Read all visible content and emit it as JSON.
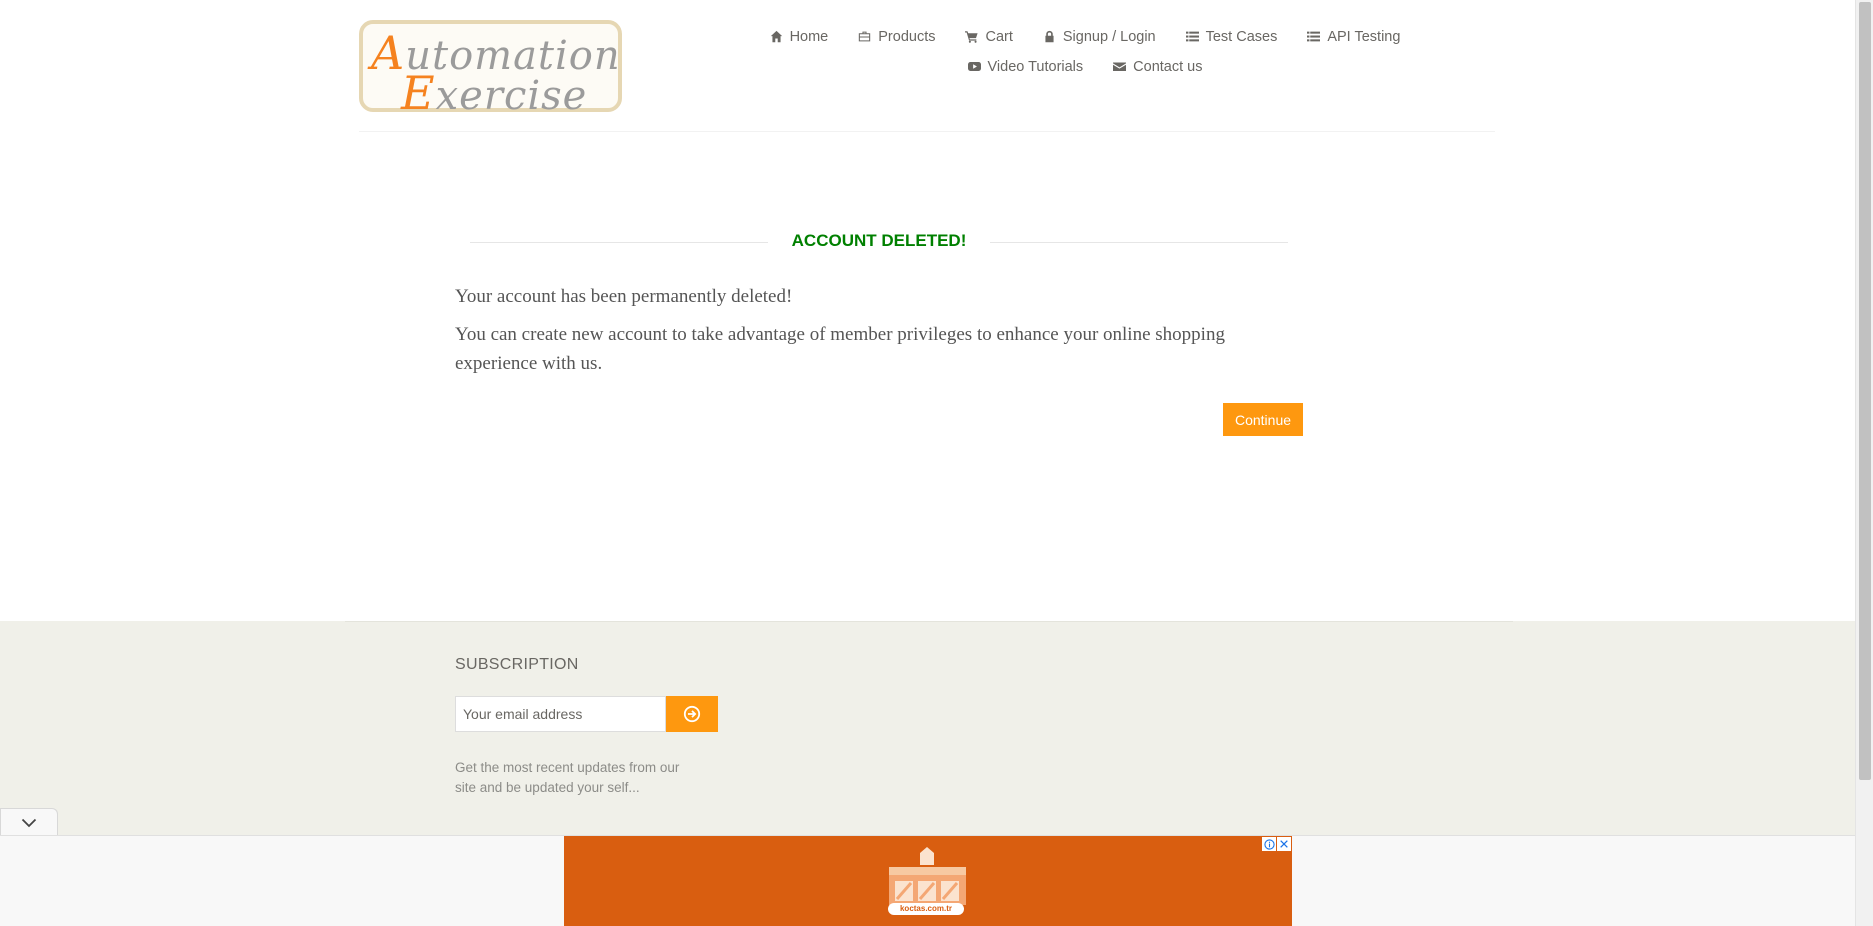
{
  "logo": {
    "line1_cap": "A",
    "line1_rest": "utomation",
    "line2_cap": "E",
    "line2_rest": "xercise"
  },
  "nav": {
    "row1": [
      {
        "label": "Home",
        "icon": "home-icon"
      },
      {
        "label": "Products",
        "icon": "briefcase-icon"
      },
      {
        "label": "Cart",
        "icon": "cart-icon"
      },
      {
        "label": "Signup / Login",
        "icon": "lock-icon"
      },
      {
        "label": "Test Cases",
        "icon": "list-icon"
      },
      {
        "label": "API Testing",
        "icon": "list-icon"
      }
    ],
    "row2": [
      {
        "label": "Video Tutorials",
        "icon": "youtube-play-icon"
      },
      {
        "label": "Contact us",
        "icon": "envelope-icon"
      }
    ]
  },
  "main": {
    "title": "ACCOUNT DELETED!",
    "message1": "Your account has been permanently deleted!",
    "message2": "You can create new account to take advantage of member privileges to enhance your online shopping experience with us.",
    "continue_label": "Continue"
  },
  "footer": {
    "subscription_title": "SUBSCRIPTION",
    "email_placeholder": "Your email address",
    "description": "Get the most recent updates from our site and be updated your self..."
  },
  "ad": {
    "url_text": "koctas.com.tr"
  },
  "colors": {
    "accent": "#fe980f",
    "success": "#008000",
    "footer_bg": "#f0f0e9",
    "ad_bg": "#d95e10"
  }
}
